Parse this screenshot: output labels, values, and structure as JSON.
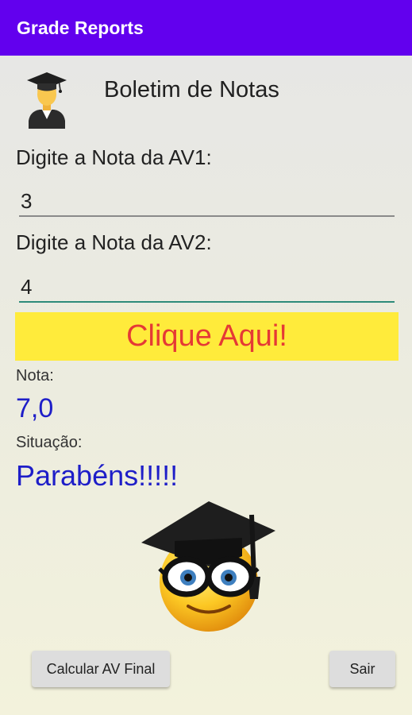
{
  "app_bar": {
    "title": "Grade Reports",
    "color": "#6200ee"
  },
  "header": {
    "icon": "graduate-icon",
    "title": "Boletim de Notas"
  },
  "form": {
    "av1_label": "Digite a Nota da AV1:",
    "av1_value": "3",
    "av2_label": "Digite a Nota da AV2:",
    "av2_value": "4"
  },
  "action_button": {
    "label": "Clique Aqui!",
    "background": "#ffeb3b",
    "text_color": "#e53935"
  },
  "result": {
    "nota_label": "Nota:",
    "nota_value": "7,0",
    "situacao_label": "Situação:",
    "situacao_value": "Parabéns!!!!!",
    "icon": "nerd-smiley-graduation-cap-icon"
  },
  "footer": {
    "calc_button": "Calcular AV Final",
    "exit_button": "Sair"
  }
}
